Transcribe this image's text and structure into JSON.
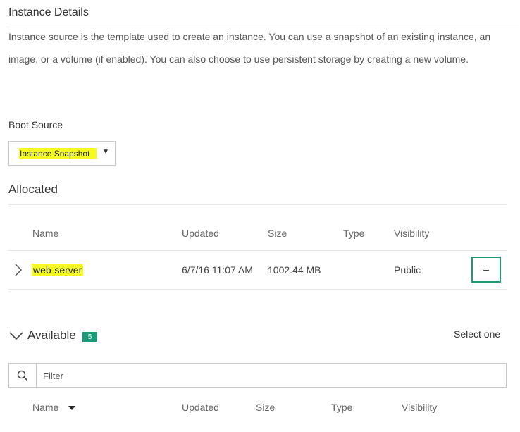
{
  "section": {
    "title": "Instance Details",
    "description": "Instance source is the template used to create an instance. You can use a snapshot of an existing instance, an image, or a volume (if enabled). You can also choose to use persistent storage by creating a new volume."
  },
  "boot_source": {
    "label": "Boot Source",
    "selected": "Instance Snapshot"
  },
  "allocated": {
    "title": "Allocated",
    "columns": {
      "name": "Name",
      "updated": "Updated",
      "size": "Size",
      "type": "Type",
      "visibility": "Visibility"
    },
    "rows": [
      {
        "name": "web-server",
        "updated": "6/7/16 11:07 AM",
        "size": "1002.44 MB",
        "type": "",
        "visibility": "Public",
        "action": "–"
      }
    ]
  },
  "available": {
    "title": "Available",
    "count": "5",
    "select_hint": "Select one",
    "filter_placeholder": "Filter",
    "columns": {
      "name": "Name",
      "updated": "Updated",
      "size": "Size",
      "type": "Type",
      "visibility": "Visibility"
    }
  },
  "colors": {
    "accent": "#1b9a78",
    "highlight": "#f5fa1f"
  },
  "icons": {
    "expand_row": "chevron-right-icon",
    "collapse_section": "chevron-down-icon",
    "search": "search-icon",
    "sort": "sort-down-icon",
    "select_caret": "caret-down-icon"
  }
}
